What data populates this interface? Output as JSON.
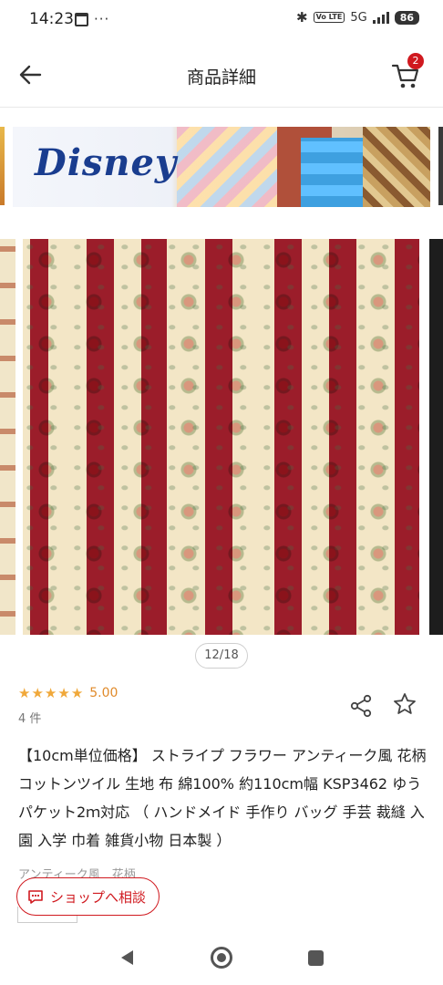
{
  "status_bar": {
    "time": "14:23",
    "dots": "···",
    "network": "5G",
    "volte": "Vo LTE",
    "battery": "86"
  },
  "header": {
    "title": "商品詳細",
    "cart_count": "2"
  },
  "banner": {
    "logo_text": "Disney"
  },
  "gallery": {
    "counter": "12/18"
  },
  "rating": {
    "stars": [
      "★",
      "★",
      "★",
      "★",
      "★"
    ],
    "value": "5.00",
    "count": "4 件"
  },
  "product": {
    "title": "【10cm単位価格】 ストライプ フラワー アンティーク風 花柄 コットンツイル 生地 布 綿100% 約110cm幅 KSP3462 ゆうパケット2ｍ対応 （ ハンドメイド 手作り バッグ 手芸 裁縫 入園 入学 巾着 雑貨小物 日本製 ）",
    "tag": "アンティーク風　花柄"
  },
  "consult_button": {
    "label": "ショップへ相談"
  },
  "colors": {
    "accent": "#d0191f",
    "star": "#f0a83a",
    "fabric_red": "#9b1d2a",
    "fabric_cream": "#f3e6c6"
  },
  "icons": {
    "back": "arrow-left-icon",
    "cart": "cart-icon",
    "share": "share-icon",
    "favorite": "star-outline-icon",
    "chat": "chat-bubble-icon"
  }
}
